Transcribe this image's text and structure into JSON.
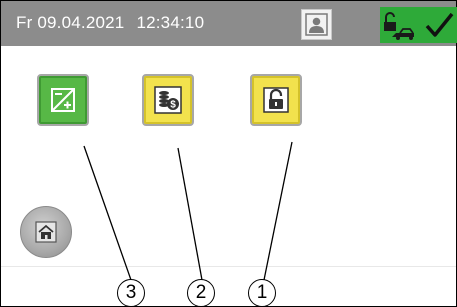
{
  "header": {
    "date": "Fr 09.04.2021",
    "time": "12:34:10",
    "icons": [
      "user-icon",
      "key-lock-icon",
      "checkmark-icon"
    ],
    "status_color": "#2eaa39",
    "background_color": "#8c8c8c"
  },
  "tiles": [
    {
      "icon": "charge-plus-minus-icon",
      "color": "#57b846"
    },
    {
      "icon": "coins-dollar-icon",
      "color": "#f2e24d"
    },
    {
      "icon": "padlock-open-icon",
      "color": "#f2e24d"
    }
  ],
  "home_button": {
    "icon": "home-icon"
  },
  "callouts": [
    "3",
    "2",
    "1"
  ]
}
